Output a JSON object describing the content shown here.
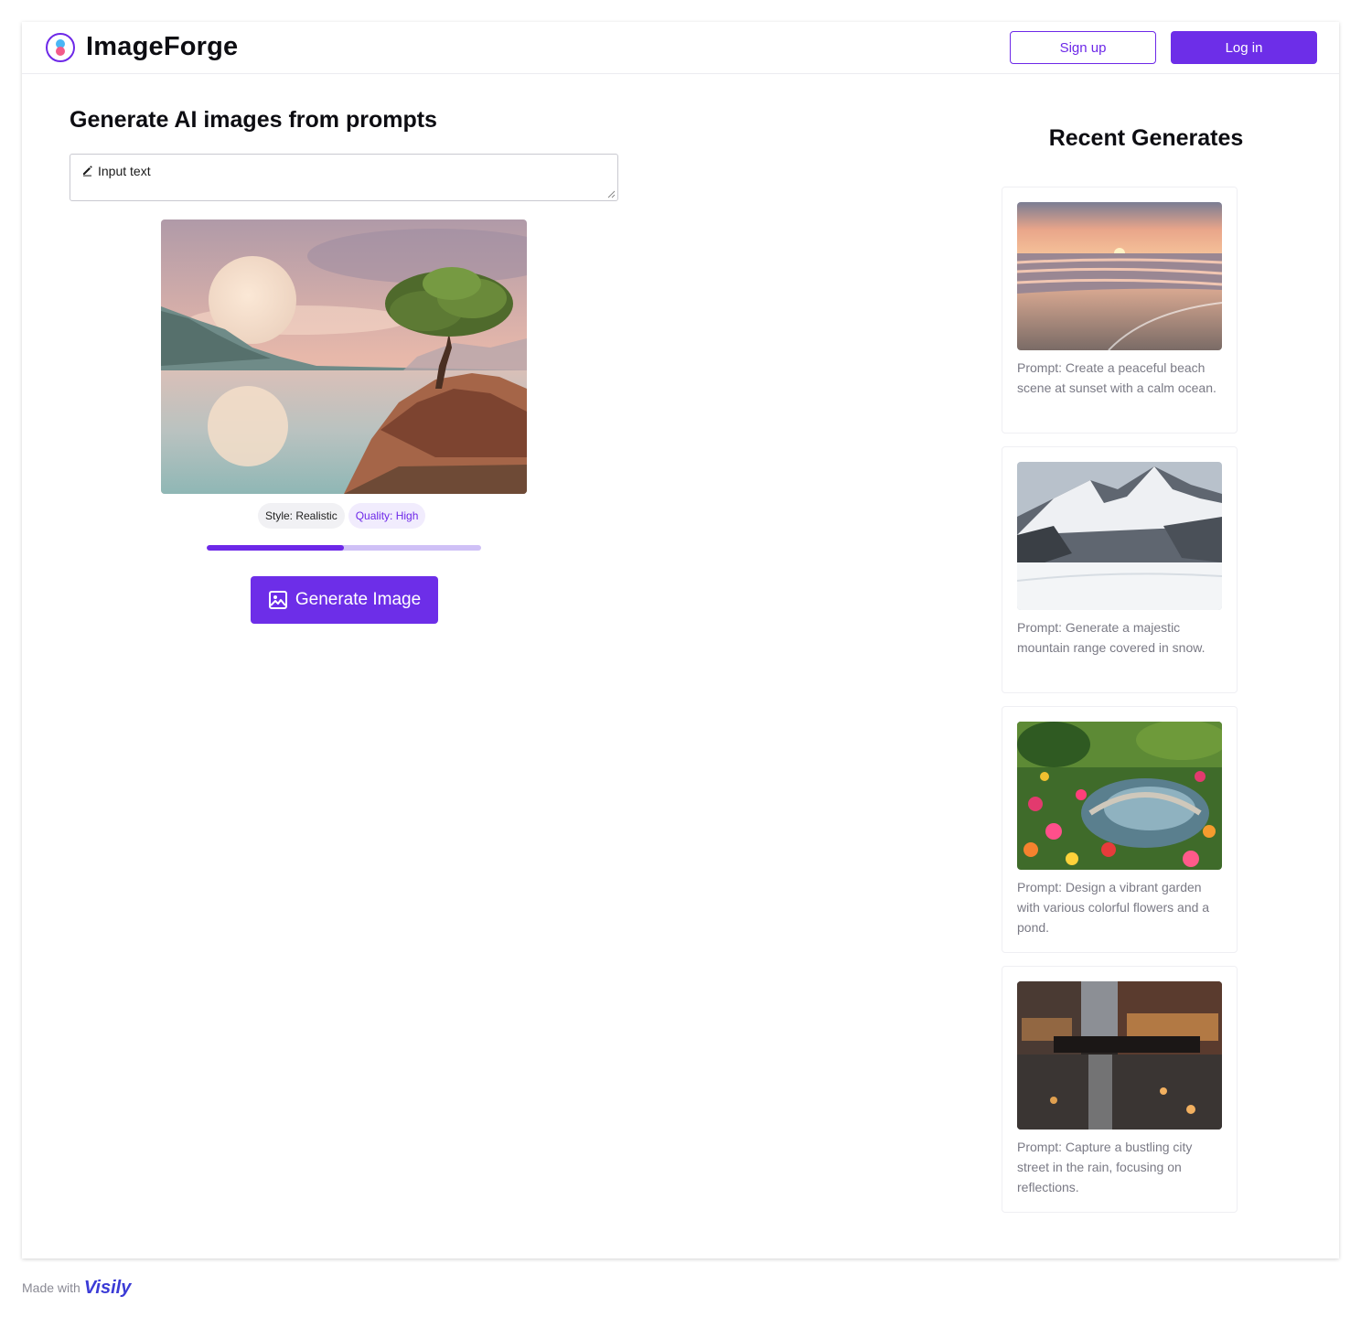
{
  "header": {
    "brand": "ImageForge",
    "signup_label": "Sign up",
    "login_label": "Log in"
  },
  "main": {
    "title": "Generate AI images from prompts",
    "prompt_placeholder": "Input text",
    "style_chip": "Style: Realistic",
    "quality_chip": "Quality: High",
    "progress": 0.5,
    "generate_label": "Generate Image"
  },
  "recent": {
    "title": "Recent Generates",
    "items": [
      {
        "caption": "Prompt: Create a peaceful beach scene at sunset with a calm ocean."
      },
      {
        "caption": "Prompt: Generate a majestic mountain range covered in snow."
      },
      {
        "caption": "Prompt: Design a vibrant garden with various colorful flowers and a pond."
      },
      {
        "caption": "Prompt: Capture a bustling city street in the rain, focusing on reflections."
      }
    ]
  },
  "footer": {
    "made_with": "Made with",
    "brand": "Visily"
  },
  "colors": {
    "accent": "#6d28e8",
    "accent_light": "#cfc0f6",
    "caption_text": "#7a7a85"
  }
}
